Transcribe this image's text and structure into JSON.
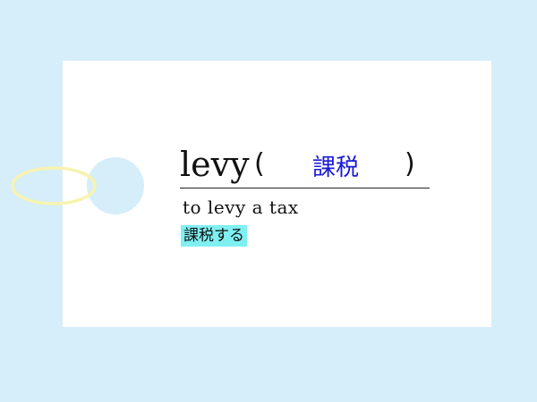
{
  "card": {
    "word": "levy",
    "paren_open": "(",
    "answer": "課税",
    "paren_close": ")",
    "example_english": "to levy a tax",
    "example_japanese": "課税する"
  },
  "colors": {
    "background": "#d6eef9",
    "card": "#ffffff",
    "answer_text": "#1a1ad6",
    "highlight": "#7ff0f2",
    "string": "#f7f3b0"
  }
}
